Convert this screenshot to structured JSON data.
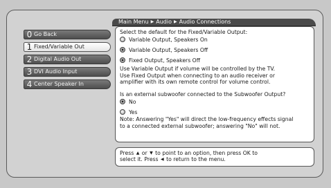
{
  "breadcrumb": [
    "Main Menu",
    "Audio",
    "Audio Connections"
  ],
  "menu": [
    {
      "num": "0",
      "label": "Go Back",
      "selected": false
    },
    {
      "num": "1",
      "label": "Fixed/Variable Out",
      "selected": true
    },
    {
      "num": "2",
      "label": "Digital Audio Out",
      "selected": false
    },
    {
      "num": "3",
      "label": "DVI Audio Input",
      "selected": false
    },
    {
      "num": "4",
      "label": "Center Speaker In",
      "selected": false
    }
  ],
  "content": {
    "prompt1": "Select the default for the Fixed/Variable Output:",
    "options1": [
      {
        "label": "Variable Output, Speakers On",
        "checked": false
      },
      {
        "label": "Variable Output, Speakers Off",
        "checked": true
      },
      {
        "label": "Fixed Output, Speakers Off",
        "checked": true
      }
    ],
    "info": [
      "Use Variable Output if volume will be controlled by the TV.",
      "Use Fixed Output when connecting to an audio receiver or",
      "amplifier with its own remote control for volume control."
    ],
    "prompt2": "Is an external subwoofer connected to the Subwoofer Output?",
    "options2": [
      {
        "label": "No",
        "checked": true
      },
      {
        "label": "Yes",
        "checked": false
      }
    ],
    "note": [
      "Note: Answering \"Yes\" will direct the low-frequency effects signal",
      "to a connected external subwoofer; answering \"No\" will not."
    ]
  },
  "hint": {
    "press": "Press",
    "or": "or",
    "line1_rest": "to point to an option, then press OK to",
    "line2_a": "select it. Press",
    "line2_b": "to return to the menu."
  }
}
